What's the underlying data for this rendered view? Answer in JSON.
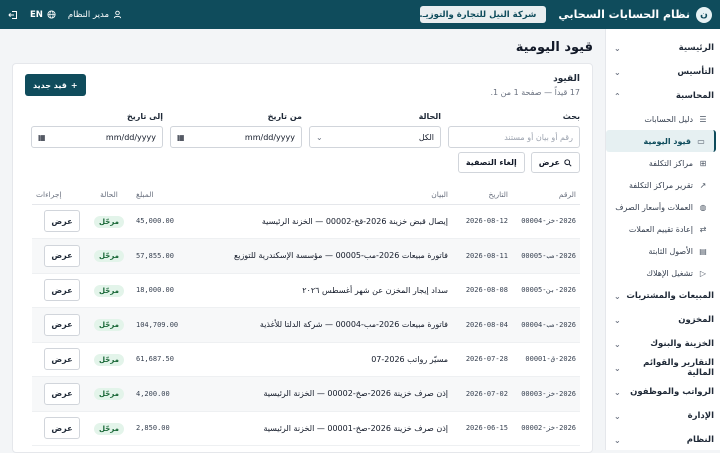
{
  "header": {
    "logo_letter": "ن",
    "app_name": "نظام الحسابات السحابي",
    "company": "شركة النيل للتجارة والتوزيـ...",
    "user": "مدير النظام",
    "language": "EN"
  },
  "sidebar": {
    "sections_top": [
      {
        "label": "الرئيسية"
      },
      {
        "label": "التأسيس"
      },
      {
        "label": "المحاسبة"
      }
    ],
    "accounting_items": [
      {
        "label": "دليل الحسابات",
        "icon": "list-icon"
      },
      {
        "label": "قيود اليومية",
        "icon": "document-icon",
        "active": true
      },
      {
        "label": "مراكز التكلفة",
        "icon": "grid-icon"
      },
      {
        "label": "تقرير مراكز التكلفة",
        "icon": "chart-icon"
      },
      {
        "label": "العملات وأسعار الصرف",
        "icon": "globe-icon"
      },
      {
        "label": "إعادة تقييم العملات",
        "icon": "swap-icon"
      },
      {
        "label": "الأصول الثابتة",
        "icon": "file-icon"
      },
      {
        "label": "تشغيل الإهلاك",
        "icon": "play-icon"
      }
    ],
    "sections_bottom": [
      {
        "label": "المبيعات والمشتريات"
      },
      {
        "label": "المخزون"
      },
      {
        "label": "الخزينة والبنوك"
      },
      {
        "label": "التقارير والقوائم المالية"
      },
      {
        "label": "الرواتب والموظفون"
      },
      {
        "label": "الإدارة"
      },
      {
        "label": "النظام"
      }
    ]
  },
  "page": {
    "title": "قيود اليومية",
    "card_title": "القيود",
    "card_subtitle": "17 قيداً — صفحة 1 من 1.",
    "new_button": "قيد جديد"
  },
  "filters": {
    "search_label": "بحث",
    "search_placeholder": "رقم أو بيان أو مستند",
    "status_label": "الحالة",
    "status_value": "الكل",
    "from_label": "من تاريخ",
    "from_placeholder": "mm/dd/yyyy",
    "to_label": "إلى تاريخ",
    "to_placeholder": "mm/dd/yyyy",
    "show_button": "عرض",
    "clear_button": "إلغاء التصفية"
  },
  "table": {
    "headers": {
      "number": "الرقم",
      "date": "التاريخ",
      "description": "البيان",
      "amount": "المبلغ",
      "status": "الحالة",
      "actions": "إجراءات"
    },
    "rows": [
      {
        "number": "2026-خز-00004",
        "date": "2026-08-12",
        "description": "إيصال قبض خزينة 2026-قخ-00002 — الخزنة الرئيسية",
        "amount": "45,000.00",
        "status": "مرحّل",
        "action": "عرض"
      },
      {
        "number": "2026-مب-00005",
        "date": "2026-08-11",
        "description": "فاتورة مبيعات 2026-مب-00005 — مؤسسة الإسكندرية للتوزيع",
        "amount": "57,855.00",
        "status": "مرحّل",
        "action": "عرض"
      },
      {
        "number": "2026-بن-00005",
        "date": "2026-08-08",
        "description": "سداد إيجار المخزن عن شهر أغسطس ٢٠٢٦",
        "amount": "18,000.00",
        "status": "مرحّل",
        "action": "عرض"
      },
      {
        "number": "2026-مب-00004",
        "date": "2026-08-04",
        "description": "فاتورة مبيعات 2026-مب-00004 — شركة الدلتا للأغذية",
        "amount": "104,709.00",
        "status": "مرحّل",
        "action": "عرض"
      },
      {
        "number": "2026-ق-00001",
        "date": "2026-07-28",
        "description": "مسيّر رواتب 2026-07",
        "amount": "61,687.50",
        "status": "مرحّل",
        "action": "عرض"
      },
      {
        "number": "2026-خز-00003",
        "date": "2026-07-02",
        "description": "إذن صرف خزينة 2026-صخ-00002 — الخزنة الرئيسية",
        "amount": "4,200.00",
        "status": "مرحّل",
        "action": "عرض"
      },
      {
        "number": "2026-خز-00002",
        "date": "2026-06-15",
        "description": "إذن صرف خزينة 2026-صخ-00001 — الخزنة الرئيسية",
        "amount": "2,850.00",
        "status": "مرحّل",
        "action": "عرض"
      }
    ]
  },
  "colors": {
    "brand": "#0f4c5c",
    "success_bg": "#e3f4ea",
    "success_text": "#166534"
  }
}
